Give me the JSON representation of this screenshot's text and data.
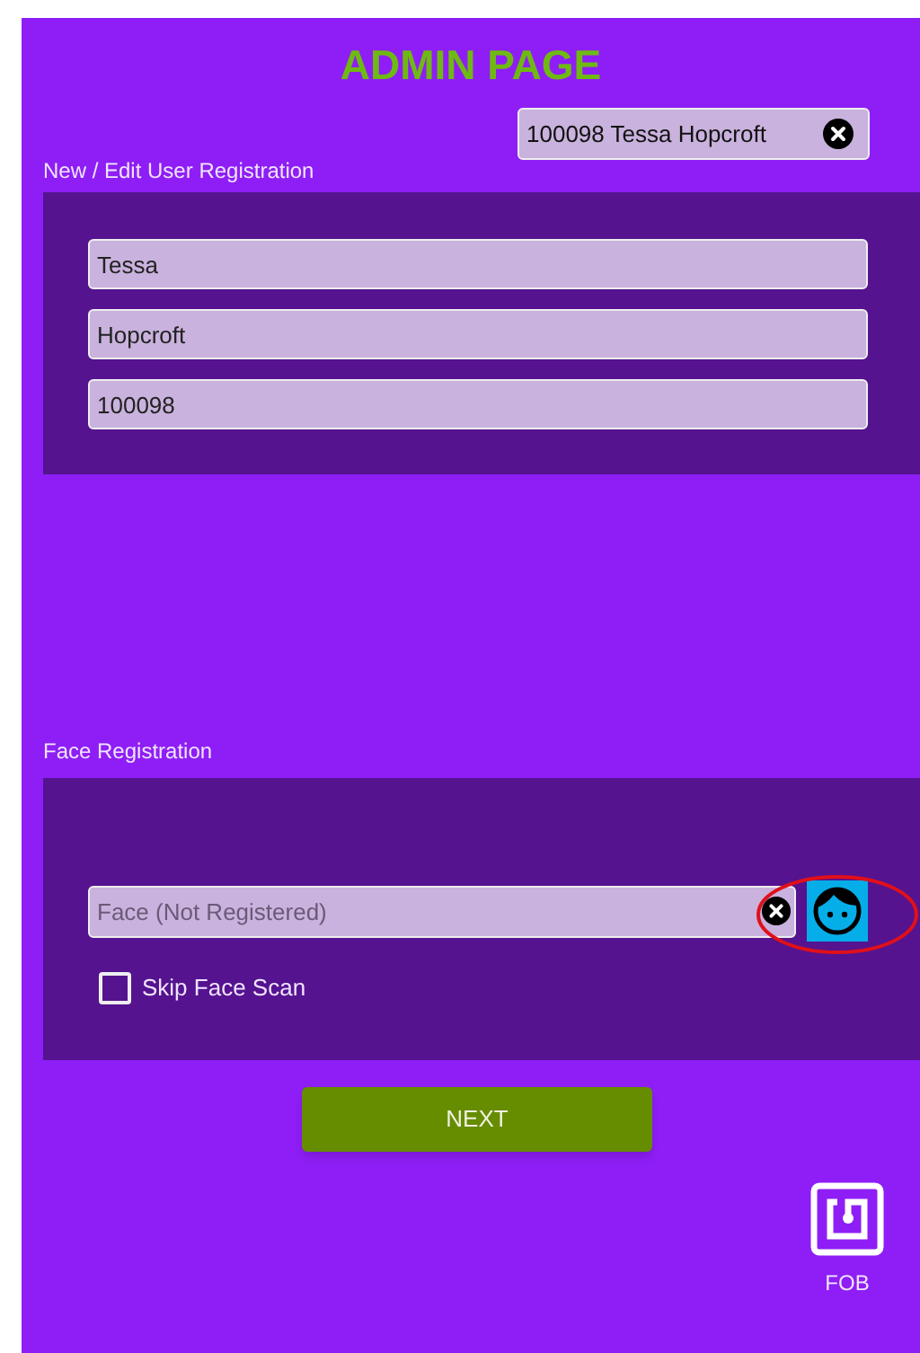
{
  "title": "ADMIN PAGE",
  "search_chip": {
    "value": "100098 Tessa Hopcroft"
  },
  "user_section": {
    "label": "New / Edit User Registration",
    "fields": [
      {
        "value": "Tessa"
      },
      {
        "value": "Hopcroft"
      },
      {
        "value": "100098"
      }
    ]
  },
  "face_section": {
    "label": "Face Registration",
    "field": {
      "placeholder": "Face (Not Registered)"
    },
    "skip_checkbox": {
      "label": "Skip Face Scan",
      "checked": false
    }
  },
  "next_button": "NEXT",
  "fob": {
    "label": "FOB"
  }
}
